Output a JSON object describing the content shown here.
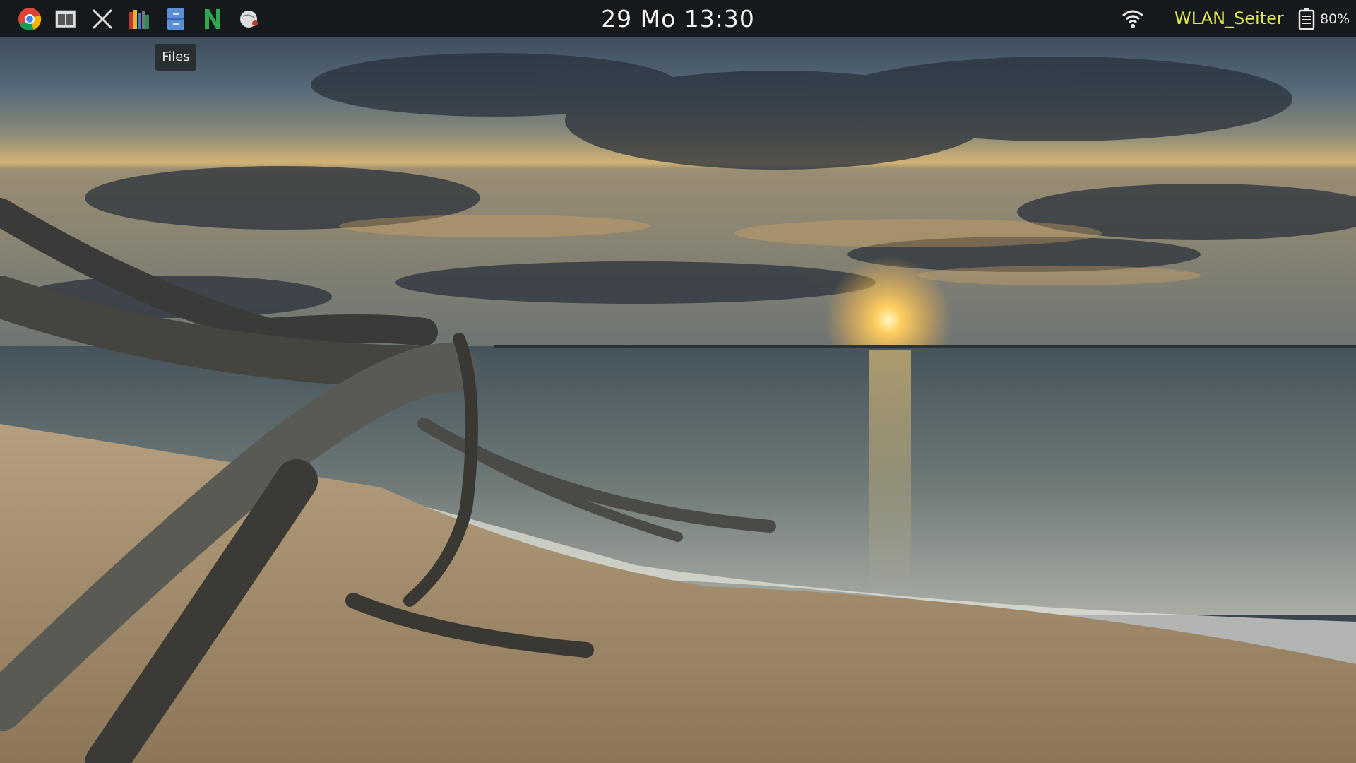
{
  "panel": {
    "launchers": [
      {
        "name": "chrome-icon"
      },
      {
        "name": "file-manager-window-icon"
      },
      {
        "name": "tools-icon"
      },
      {
        "name": "library-books-icon"
      },
      {
        "name": "files-cabinet-icon"
      },
      {
        "name": "n-app-icon"
      },
      {
        "name": "globe-app-icon"
      }
    ],
    "clock": "29 Mo 13:30",
    "network": {
      "name": "WLAN_Seiter",
      "icon": "wifi-icon",
      "color": "#dfe64c"
    },
    "battery": {
      "percent": "80%",
      "icon": "battery-icon"
    }
  },
  "tooltip": {
    "text": "Files"
  },
  "wallpaper": {
    "description_icon": "beach-sunset-driftwood"
  }
}
